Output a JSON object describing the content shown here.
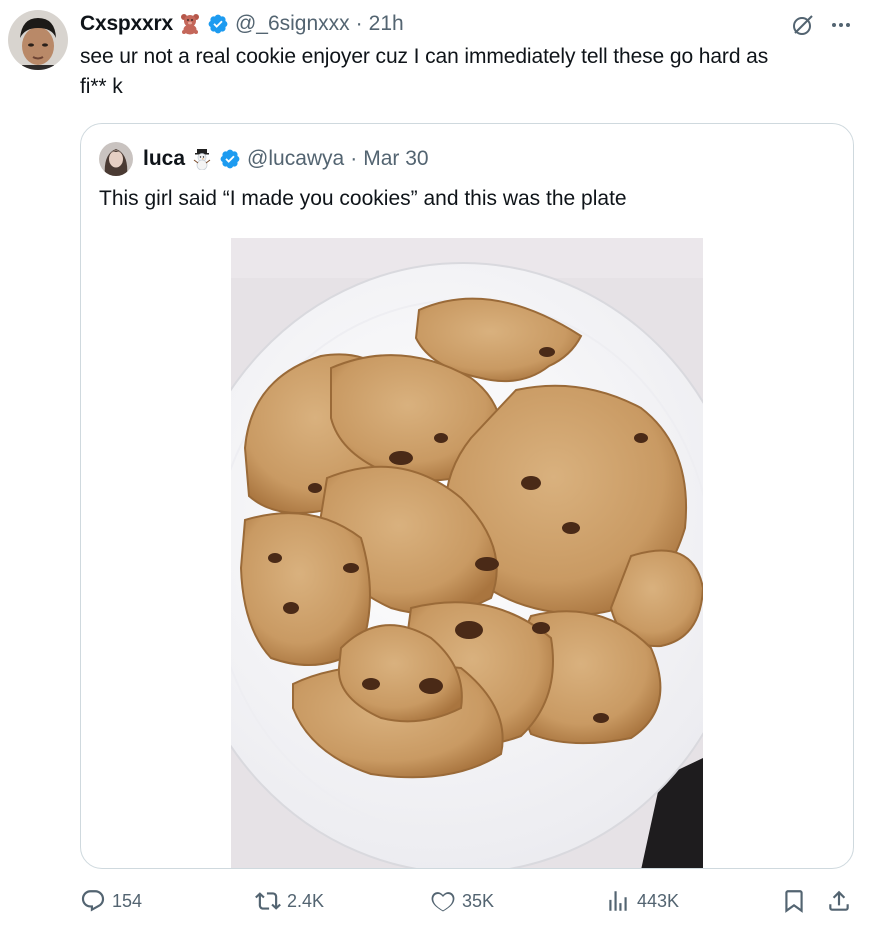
{
  "tweet": {
    "author": {
      "display_name": "Cxspxxrx",
      "name_emoji": "bear-emoji",
      "handle": "@_6signxxx",
      "separator": "·",
      "time": "21h"
    },
    "text_line1": "see ur not a real cookie enjoyer cuz I can immediately tell these go hard as",
    "text_line2": "f",
    "text_censor": "i** k",
    "quote": {
      "author": {
        "display_name": "luca",
        "name_emoji": "snowman-emoji",
        "handle": "@lucawya",
        "separator": "·",
        "date": "Mar 30"
      },
      "text": "This girl said “I made you cookies” and this was the plate",
      "media_description": "plate of broken chocolate chip cookies"
    },
    "actions": {
      "reply_count": "154",
      "repost_count": "2.4K",
      "like_count": "35K",
      "view_count": "443K"
    }
  },
  "colors": {
    "text": "#0f1419",
    "muted": "#536471",
    "verified": "#1d9bf0",
    "border": "#cfd9de"
  }
}
